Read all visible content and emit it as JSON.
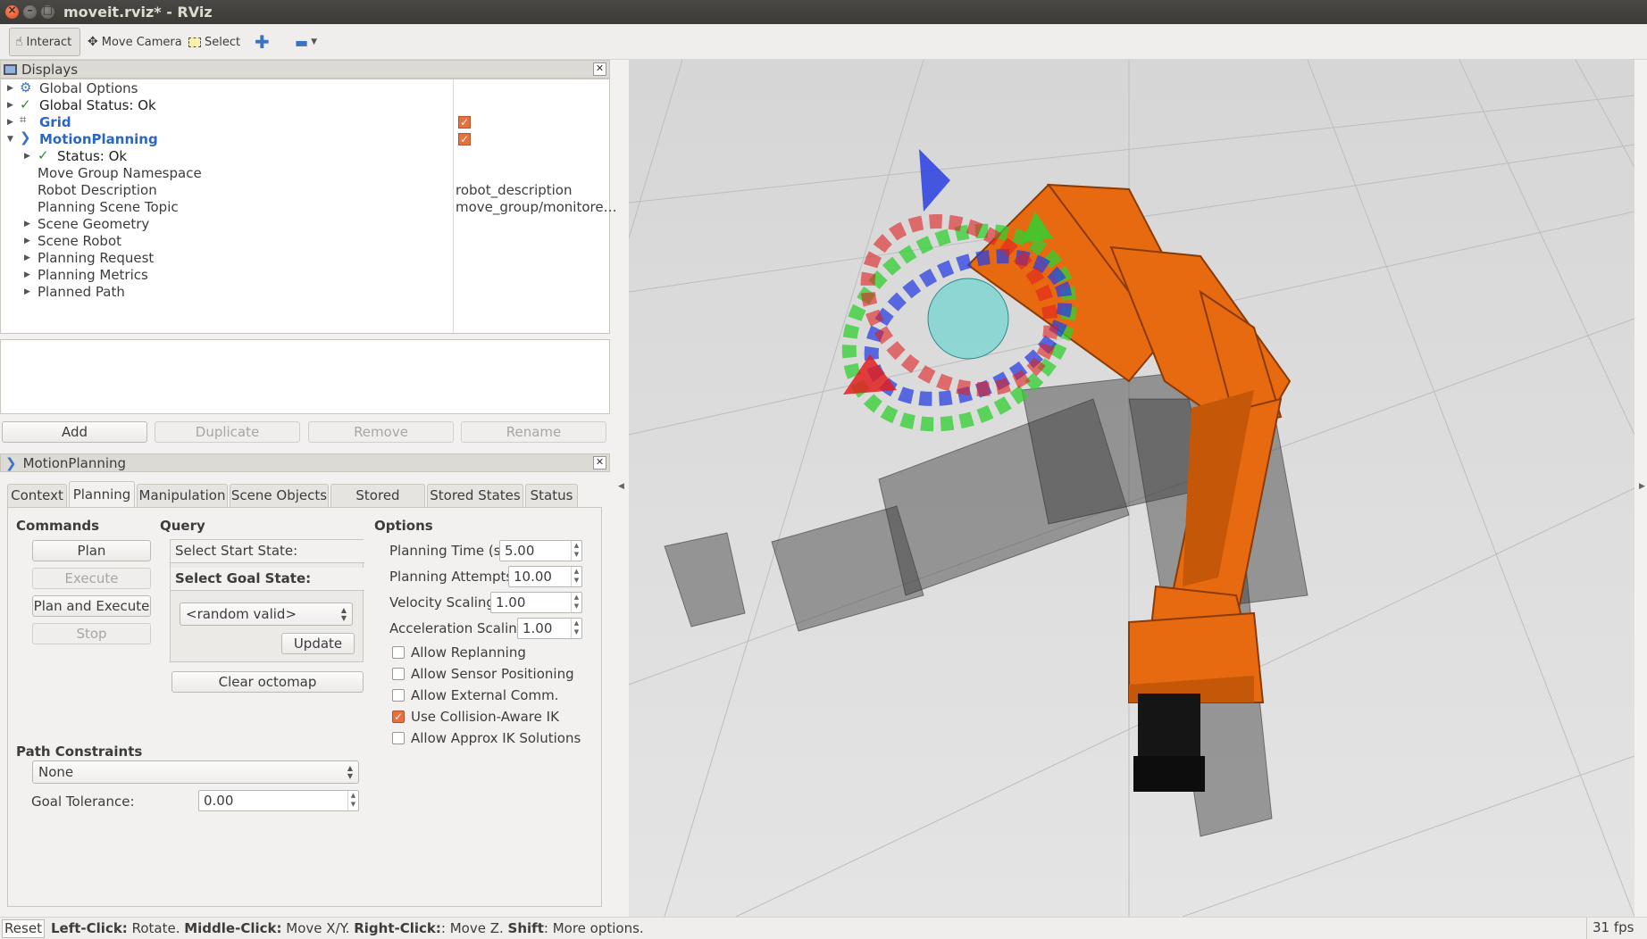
{
  "window": {
    "title": "moveit.rviz* - RViz"
  },
  "toolbar": {
    "interact": "Interact",
    "move_camera": "Move Camera",
    "select": "Select"
  },
  "displays": {
    "title": "Displays",
    "items": [
      {
        "label": "Global Options"
      },
      {
        "label": "Global Status: Ok"
      },
      {
        "label": "Grid"
      },
      {
        "label": "MotionPlanning"
      },
      {
        "label": "Status: Ok"
      },
      {
        "label": "Move Group Namespace",
        "value": ""
      },
      {
        "label": "Robot Description",
        "value": "robot_description"
      },
      {
        "label": "Planning Scene Topic",
        "value": "move_group/monitore…"
      },
      {
        "label": "Scene Geometry"
      },
      {
        "label": "Scene Robot"
      },
      {
        "label": "Planning Request"
      },
      {
        "label": "Planning Metrics"
      },
      {
        "label": "Planned Path"
      }
    ],
    "buttons": {
      "add": "Add",
      "duplicate": "Duplicate",
      "remove": "Remove",
      "rename": "Rename"
    }
  },
  "motion_panel": {
    "title": "MotionPlanning",
    "tabs": [
      "Context",
      "Planning",
      "Manipulation",
      "Scene Objects",
      "Stored Scenes",
      "Stored States",
      "Status"
    ],
    "active_tab": "Planning",
    "commands": {
      "heading": "Commands",
      "plan": "Plan",
      "execute": "Execute",
      "plan_execute": "Plan and Execute",
      "stop": "Stop"
    },
    "query": {
      "heading": "Query",
      "start": "Select Start State:",
      "goal": "Select Goal State:",
      "goal_value": "<random valid>",
      "update": "Update",
      "clear_octomap": "Clear octomap"
    },
    "options": {
      "heading": "Options",
      "planning_time_label": "Planning Time (s):",
      "planning_time": "5.00",
      "planning_attempts_label": "Planning Attempts:",
      "planning_attempts": "10.00",
      "velocity_label": "Velocity Scaling:",
      "velocity": "1.00",
      "acceleration_label": "Acceleration Scaling:",
      "acceleration": "1.00",
      "checks": [
        {
          "label": "Allow Replanning",
          "checked": false
        },
        {
          "label": "Allow Sensor Positioning",
          "checked": false
        },
        {
          "label": "Allow External Comm.",
          "checked": false
        },
        {
          "label": "Use Collision-Aware IK",
          "checked": true
        },
        {
          "label": "Allow Approx IK Solutions",
          "checked": false
        }
      ]
    },
    "path_constraints": {
      "heading": "Path Constraints",
      "value": "None",
      "goal_tolerance_label": "Goal Tolerance:",
      "goal_tolerance": "0.00"
    }
  },
  "statusbar": {
    "reset": "Reset",
    "hint_left": "Left-Click:",
    "hint_left_action": " Rotate. ",
    "hint_middle": "Middle-Click:",
    "hint_middle_action": " Move X/Y. ",
    "hint_right": "Right-Click:",
    "hint_right_action": ": Move Z. ",
    "hint_shift": "Shift",
    "hint_shift_action": ": More options.",
    "fps": "31 fps"
  },
  "colors": {
    "robot_orange": "#e86a10",
    "accent_blue": "#2a66c6",
    "check_orange": "#e8703c"
  }
}
